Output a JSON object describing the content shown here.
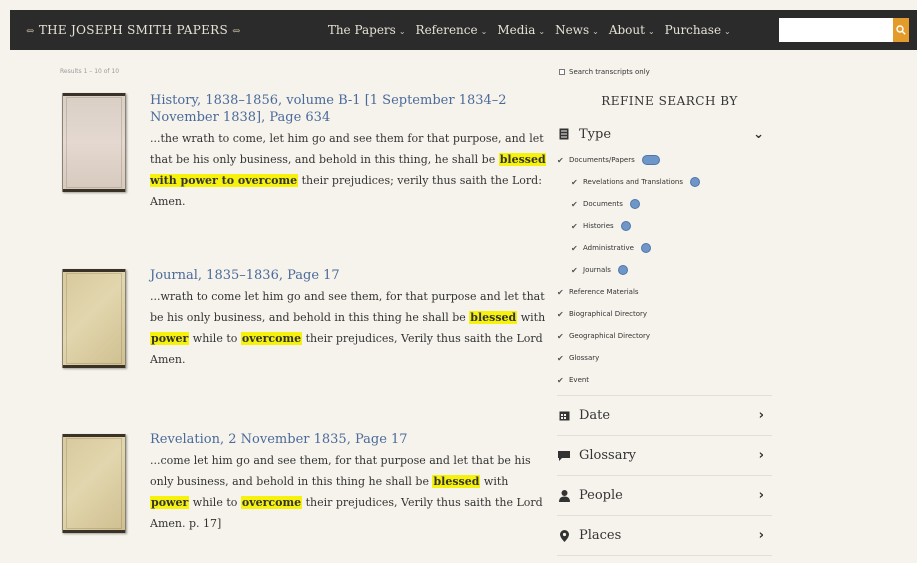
{
  "header": {
    "brand": "THE JOSEPH SMITH PAPERS",
    "brand_ornament": "⇔",
    "nav": [
      {
        "label": "The Papers"
      },
      {
        "label": "Reference"
      },
      {
        "label": "Media"
      },
      {
        "label": "News"
      },
      {
        "label": "About"
      },
      {
        "label": "Purchase"
      }
    ],
    "search_placeholder": ""
  },
  "results_count": "Results 1 – 10 of 10",
  "results": [
    {
      "title": "History, 1838–1856, volume B-1 [1 September 1834–2 November 1838], Page 634",
      "pre": "...the wrath to come, let him go and see them for that purpose, and let that be his only business, and behold in this thing, he shall be ",
      "h1": "blessed with power to overcome",
      "post": " their prejudices; verily thus saith the Lord: Amen."
    },
    {
      "title": "Journal, 1835–1836, Page 17",
      "pre": "...wrath to come let him go and see them, for that purpose and let that be his only business, and behold in this thing he shall be ",
      "h1": "blessed",
      "mid1": " with ",
      "h2": "power",
      "mid2": " while to ",
      "h3": "overcome",
      "post": " their prejudices, Verily thus saith the Lord Amen."
    },
    {
      "title": "Revelation, 2 November 1835, Page 17",
      "pre": "...come let him go and see them, for that purpose and let that be his only business, and behold in this thing he shall be ",
      "h1": "blessed",
      "mid1": " with ",
      "h2": "power",
      "mid2": " while to ",
      "h3": "overcome",
      "post": " their prejudices, Verily thus saith the Lord Amen. p. 17]"
    }
  ],
  "sidebar": {
    "search_transcripts": "Search transcripts only",
    "refine_title": "REFINE SEARCH BY",
    "type_label": "Type",
    "type_items": [
      {
        "label": "Documents/Papers",
        "sub": false
      },
      {
        "label": "Revelations and Translations",
        "sub": true
      },
      {
        "label": "Documents",
        "sub": true
      },
      {
        "label": "Histories",
        "sub": true
      },
      {
        "label": "Administrative",
        "sub": true
      },
      {
        "label": "Journals",
        "sub": true
      },
      {
        "label": "Reference Materials",
        "sub": false
      },
      {
        "label": "Biographical Directory",
        "sub": false
      },
      {
        "label": "Geographical Directory",
        "sub": false
      },
      {
        "label": "Glossary",
        "sub": false
      },
      {
        "label": "Event",
        "sub": false
      }
    ],
    "facets": [
      {
        "label": "Date",
        "icon": "calendar-icon"
      },
      {
        "label": "Glossary",
        "icon": "comment-icon"
      },
      {
        "label": "People",
        "icon": "person-icon"
      },
      {
        "label": "Places",
        "icon": "map-pin-icon"
      }
    ]
  }
}
